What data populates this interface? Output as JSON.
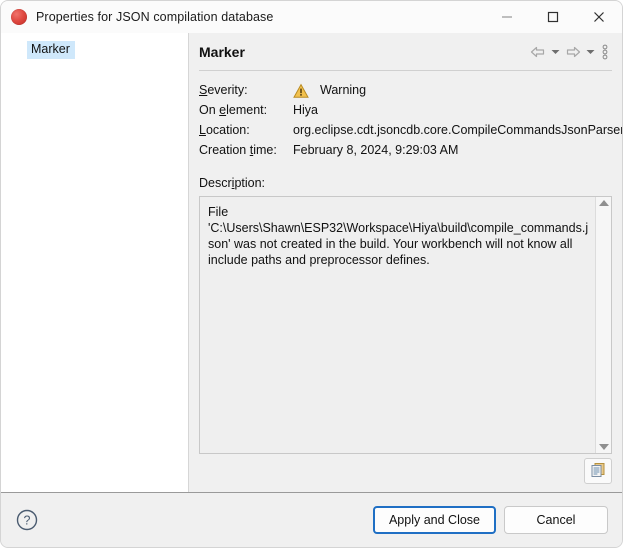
{
  "window": {
    "title": "Properties for JSON compilation database",
    "app_icon": "eclipse-icon",
    "controls": {
      "minimize": "minimize-icon",
      "maximize": "maximize-icon",
      "close": "close-icon"
    }
  },
  "sidebar": {
    "items": [
      {
        "label": "Marker",
        "selected": true
      }
    ]
  },
  "panel": {
    "title": "Marker",
    "tools": [
      {
        "name": "back-arrow-icon",
        "label": "Back"
      },
      {
        "name": "back-dropdown-caret-icon",
        "label": "Back history"
      },
      {
        "name": "forward-arrow-icon",
        "label": "Forward"
      },
      {
        "name": "forward-dropdown-caret-icon",
        "label": "Forward history"
      },
      {
        "name": "view-menu-icon",
        "label": "View Menu"
      }
    ],
    "fields": [
      {
        "label_pre": "S",
        "label_mn": "e",
        "label_post": "verity:",
        "label_full": "Severity:",
        "value": "Warning",
        "icon": "warning-icon"
      },
      {
        "label_pre": "On ",
        "label_mn": "e",
        "label_post": "lement:",
        "label_full": "On element:",
        "value": "Hiya"
      },
      {
        "label_pre": "",
        "label_mn": "L",
        "label_post": "ocation:",
        "label_full": "Location:",
        "value": "org.eclipse.cdt.jsoncdb.core.CompileCommandsJsonParser"
      },
      {
        "label_pre": "Creation ",
        "label_mn": "t",
        "label_post": "ime:",
        "label_full": "Creation time:",
        "value": "February 8, 2024, 9:29:03 AM"
      }
    ],
    "description": {
      "label_pre": "Descr",
      "label_mn": "i",
      "label_post": "ption:",
      "label_full": "Description:",
      "text": "File 'C:\\Users\\Shawn\\ESP32\\Workspace\\Hiya\\build\\compile_commands.json' was not created in the build. Your workbench will not know all include paths and preprocessor defines.",
      "scrollbar": {
        "up": "scroll-up-arrow-icon",
        "down": "scroll-down-arrow-icon"
      }
    },
    "copy_button": {
      "name": "copy-to-clipboard-icon",
      "label": "Copy to clipboard"
    }
  },
  "footer": {
    "help": "help-icon",
    "apply_label": "Apply and Close",
    "cancel_label": "Cancel"
  },
  "colors": {
    "selection_blue": "#cfe8fb",
    "default_button_border": "#1f6fc4",
    "warning_amber": "#f0b323",
    "panel_bg": "#f0f0f0",
    "titlebar_bg": "#fbfbfb"
  }
}
